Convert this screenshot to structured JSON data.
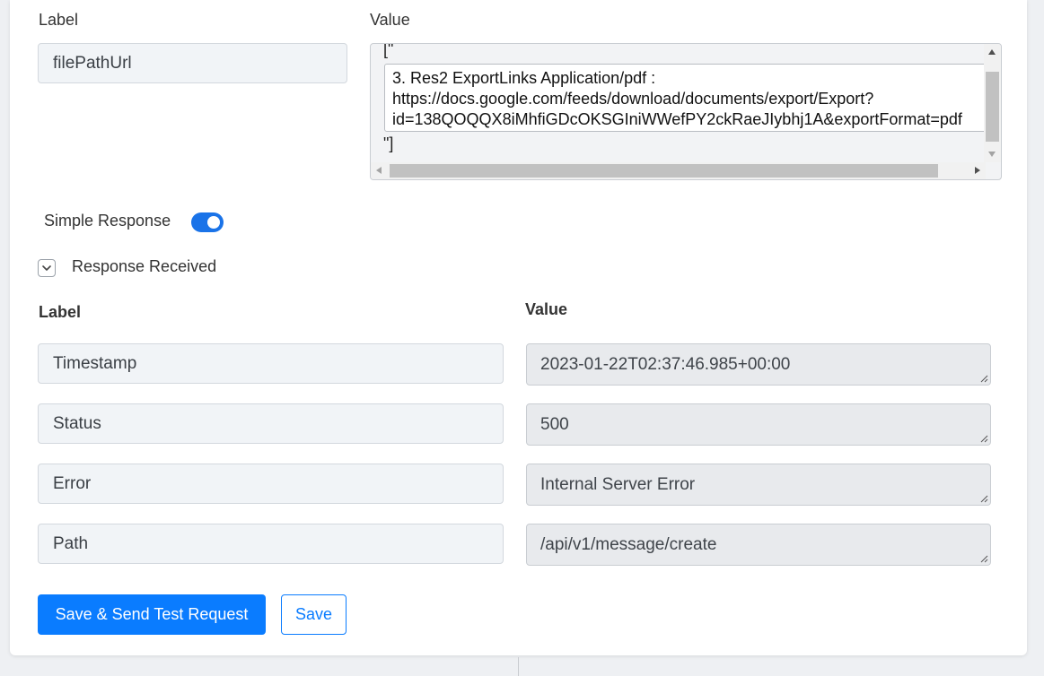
{
  "request_header": {
    "label_heading": "Label",
    "value_heading": "Value",
    "label_field": "filePathUrl",
    "value_prefix": "[\"",
    "value_lines": [
      "3. Res2 ExportLinks Application/pdf :",
      "https://docs.google.com/feeds/download/documents/export/Export?",
      "id=138QOQQX8iMhfiGDcOKSGIniWWefPY2ckRaeJIybhj1A&exportFormat=pdf"
    ],
    "value_suffix": "\"]"
  },
  "simple_response": {
    "label": "Simple Response",
    "enabled": true
  },
  "response_received": {
    "label": "Response Received",
    "label_heading": "Label",
    "value_heading": "Value",
    "rows": [
      {
        "label": "Timestamp",
        "value": "2023-01-22T02:37:46.985+00:00"
      },
      {
        "label": "Status",
        "value": "500"
      },
      {
        "label": "Error",
        "value": "Internal Server Error"
      },
      {
        "label": "Path",
        "value": "/api/v1/message/create"
      }
    ]
  },
  "actions": {
    "save_send_label": "Save & Send Test Request",
    "save_label": "Save"
  },
  "colors": {
    "accent": "#0a7cff",
    "toggle_on": "#1a73e8"
  }
}
